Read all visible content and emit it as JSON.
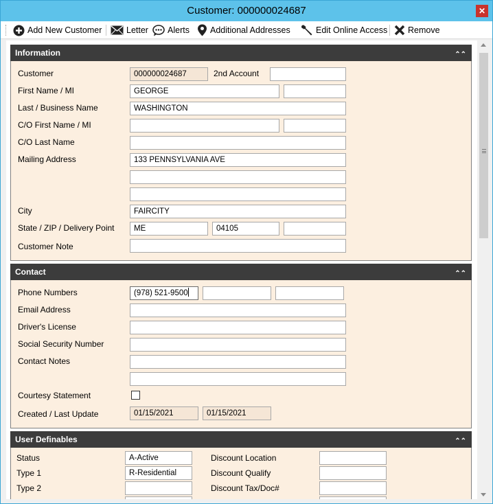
{
  "window": {
    "title": "Customer: 000000024687",
    "close_glyph": "✕"
  },
  "toolbar": {
    "add_new_customer": "Add New Customer",
    "letter": "Letter",
    "alerts": "Alerts",
    "additional_addresses": "Additional Addresses",
    "edit_online_access": "Edit Online Access",
    "remove": "Remove"
  },
  "information": {
    "header": "Information",
    "labels": {
      "customer": "Customer",
      "second_account": "2nd Account",
      "first_name_mi": "First Name / MI",
      "last_business_name": "Last / Business Name",
      "co_first_name_mi": "C/O First Name / MI",
      "co_last_name": "C/O Last Name",
      "mailing_address": "Mailing Address",
      "city": "City",
      "state_zip_delivery": "State / ZIP / Delivery Point",
      "customer_note": "Customer Note"
    },
    "values": {
      "customer": "000000024687",
      "second_account": "",
      "first_name": "GEORGE",
      "mi": "",
      "last_business_name": "WASHINGTON",
      "co_first_name": "",
      "co_mi": "",
      "co_last_name": "",
      "mailing_address_1": "133 PENNSYLVANIA AVE",
      "mailing_address_2": "",
      "mailing_address_3": "",
      "city": "FAIRCITY",
      "state": "ME",
      "zip": "04105",
      "delivery_point": "",
      "customer_note": ""
    }
  },
  "contact": {
    "header": "Contact",
    "labels": {
      "phone_numbers": "Phone Numbers",
      "email_address": "Email Address",
      "drivers_license": "Driver's License",
      "ssn": "Social Security Number",
      "contact_notes": "Contact Notes",
      "courtesy_statement": "Courtesy Statement",
      "created_last_update": "Created / Last Update"
    },
    "values": {
      "phone_1": "(978) 521-9500",
      "phone_2": "",
      "phone_3": "",
      "email": "",
      "drivers_license": "",
      "ssn": "",
      "contact_notes_1": "",
      "contact_notes_2": "",
      "courtesy_statement_checked": false,
      "created": "01/15/2021",
      "last_update": "01/15/2021"
    }
  },
  "user_definables": {
    "header": "User Definables",
    "labels": {
      "status": "Status",
      "type1": "Type 1",
      "type2": "Type 2",
      "discount_location": "Discount Location",
      "discount_qualify": "Discount Qualify",
      "discount_tax_doc": "Discount Tax/Doc#"
    },
    "values": {
      "status": "A-Active",
      "type1": "R-Residential",
      "type2": "",
      "discount_location": "",
      "discount_qualify": "",
      "discount_tax_doc": ""
    }
  },
  "collapse_glyph": "⌃⌃"
}
